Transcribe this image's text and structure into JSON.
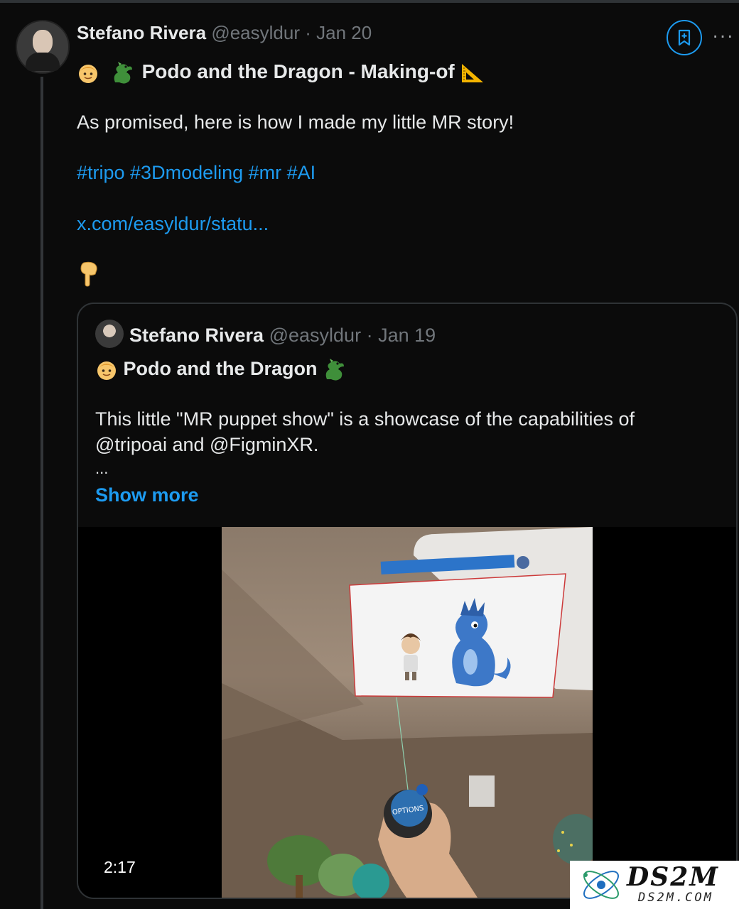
{
  "tweet": {
    "author_name": "Stefano Rivera",
    "handle": "@easyldur",
    "separator": "·",
    "date": "Jan 20",
    "title": "Podo and the Dragon - Making-of",
    "body": "As promised, here is how I made my little MR story!",
    "hashtags": "#tripo #3Dmodeling #mr #AI",
    "link": "x.com/easyldur/statu...",
    "more_label": "···"
  },
  "quoted": {
    "author_name": "Stefano Rivera",
    "handle": "@easyldur",
    "separator": "·",
    "date": "Jan 19",
    "title": "Podo and the Dragon",
    "body": "This little \"MR puppet show\" is a showcase of the capabilities of @tripoai and @FigminXR.",
    "ellipsis": "...",
    "show_more": "Show more",
    "video_duration": "2:17",
    "video_button_text": "OPTIONS"
  },
  "watermark": {
    "main": "DS2M",
    "sub": "DS2M.COM"
  },
  "colors": {
    "background": "#0b0b0b",
    "accent": "#1d9bf0",
    "text": "#e7e9ea",
    "muted": "#71767b",
    "border": "#2f3336"
  },
  "icons": [
    "boy-emoji-icon",
    "dragon-emoji-icon",
    "triangle-ruler-emoji-icon",
    "pointing-down-emoji-icon",
    "bookmark-add-icon",
    "more-icon"
  ]
}
